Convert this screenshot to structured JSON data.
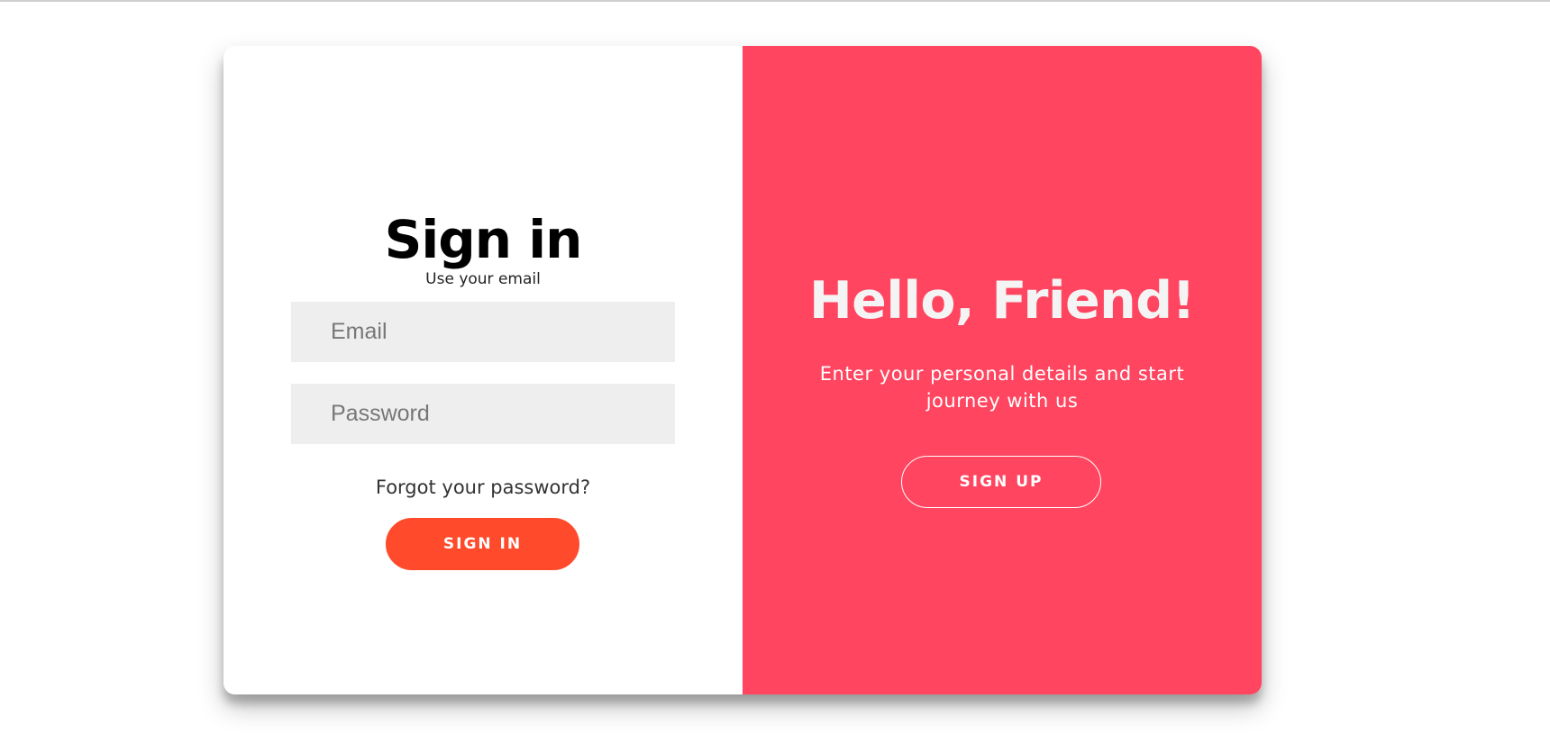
{
  "signin": {
    "title": "Sign in",
    "subtitle": "Use your email",
    "email_placeholder": "Email",
    "password_placeholder": "Password",
    "forgot_link": "Forgot your password?",
    "button_label": "SIGN IN"
  },
  "overlay": {
    "heading": "Hello, Friend!",
    "description": "Enter your personal details and start journey with us",
    "button_label": "SIGN UP"
  },
  "colors": {
    "accent": "#ff4b2b",
    "overlay_background": "#ff4560",
    "input_background": "#eeeeee"
  }
}
